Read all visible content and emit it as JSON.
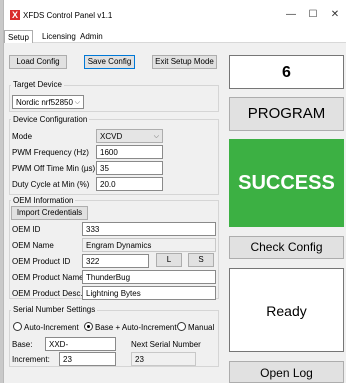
{
  "window": {
    "title": "XFDS Control Panel v1.1",
    "app_icon_letter": "X",
    "minimize_glyph": "—",
    "maximize_glyph": "☐",
    "close_glyph": "✕"
  },
  "tabs": [
    {
      "label": "Setup"
    },
    {
      "label": "Licensing"
    },
    {
      "label": "Admin"
    }
  ],
  "toolbar": {
    "load_config": "Load Config",
    "save_config": "Save Config",
    "exit_setup": "Exit Setup Mode"
  },
  "target_device": {
    "group_label": "Target Device",
    "selected": "Nordic nrf52850"
  },
  "device_config": {
    "group_label": "Device Configuration",
    "mode_label": "Mode",
    "mode_value": "XCVD",
    "pwm_freq_label": "PWM Frequency (Hz)",
    "pwm_freq_value": "1600",
    "pwm_off_label": "PWM Off Time Min (µs)",
    "pwm_off_value": "35",
    "duty_label": "Duty Cycle at Min (%)",
    "duty_value": "20.0"
  },
  "oem": {
    "group_label": "OEM Information",
    "import_button": "Import Credentials",
    "id_label": "OEM ID",
    "id_value": "333",
    "name_label": "OEM Name",
    "name_value": "Engram Dynamics",
    "product_id_label": "OEM Product ID",
    "product_id_value": "322",
    "l_button": "L",
    "s_button": "S",
    "product_name_label": "OEM Product Name",
    "product_name_value": "ThunderBug",
    "product_desc_label": "OEM Product Desc.",
    "product_desc_value": "Lightning Bytes"
  },
  "serial": {
    "group_label": "Serial Number Settings",
    "opt_auto": "Auto-Increment",
    "opt_base_auto": "Base + Auto-Increment",
    "opt_manual": "Manual",
    "selected_option": "Base + Auto-Increment",
    "base_label": "Base:",
    "base_value": "XXD-",
    "next_label": "Next Serial Number",
    "increment_label": "Increment:",
    "increment_value": "23",
    "next_value": "23"
  },
  "right_panel": {
    "count": "6",
    "program_button": "PROGRAM",
    "status_text": "SUCCESS",
    "status_color": "#3cb043",
    "check_config_button": "Check Config",
    "state_text": "Ready",
    "open_log_button": "Open Log"
  }
}
